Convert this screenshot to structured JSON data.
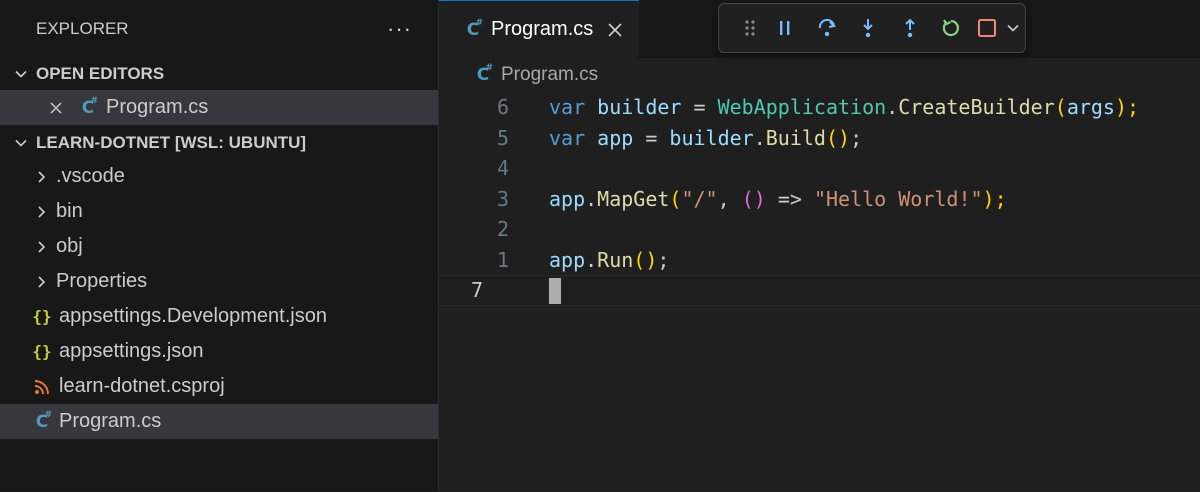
{
  "explorer": {
    "title": "EXPLORER",
    "more": "···",
    "open_editors": {
      "title": "OPEN EDITORS",
      "items": [
        {
          "label": "Program.cs",
          "icon": "csharp-icon"
        }
      ]
    },
    "workspace": {
      "title": "LEARN-DOTNET [WSL: UBUNTU]",
      "items": [
        {
          "label": ".vscode",
          "type": "folder"
        },
        {
          "label": "bin",
          "type": "folder"
        },
        {
          "label": "obj",
          "type": "folder"
        },
        {
          "label": "Properties",
          "type": "folder"
        },
        {
          "label": "appsettings.Development.json",
          "type": "json"
        },
        {
          "label": "appsettings.json",
          "type": "json"
        },
        {
          "label": "learn-dotnet.csproj",
          "type": "rss"
        },
        {
          "label": "Program.cs",
          "type": "csharp"
        }
      ]
    }
  },
  "editor": {
    "tab": {
      "label": "Program.cs"
    },
    "breadcrumb": "Program.cs",
    "lines": [
      {
        "num": "6"
      },
      {
        "num": "5"
      },
      {
        "num": "4"
      },
      {
        "num": "3"
      },
      {
        "num": "2"
      },
      {
        "num": "1"
      },
      {
        "num": "7"
      }
    ],
    "code": {
      "l6": [
        "var",
        " ",
        "builder",
        " = ",
        "WebApplication",
        ".",
        "CreateBuilder",
        "(",
        "args",
        ");"
      ],
      "l5": [
        "var",
        " ",
        "app",
        " = ",
        "builder",
        ".",
        "Build",
        "()",
        ";"
      ],
      "l3": [
        "app",
        ".",
        "MapGet",
        "(",
        "\"/\"",
        ", ",
        "()",
        " => ",
        "\"Hello World!\"",
        ");"
      ],
      "l1": [
        "app",
        ".",
        "Run",
        "()",
        ";"
      ]
    }
  },
  "debug_toolbar": {
    "buttons": [
      "drag-handle",
      "pause",
      "step-over",
      "step-into",
      "step-out",
      "restart",
      "stop"
    ]
  },
  "colors": {
    "accent": "#0078d4",
    "restart": "#89d185",
    "stop": "#f48771",
    "debug_blue": "#75beff"
  }
}
